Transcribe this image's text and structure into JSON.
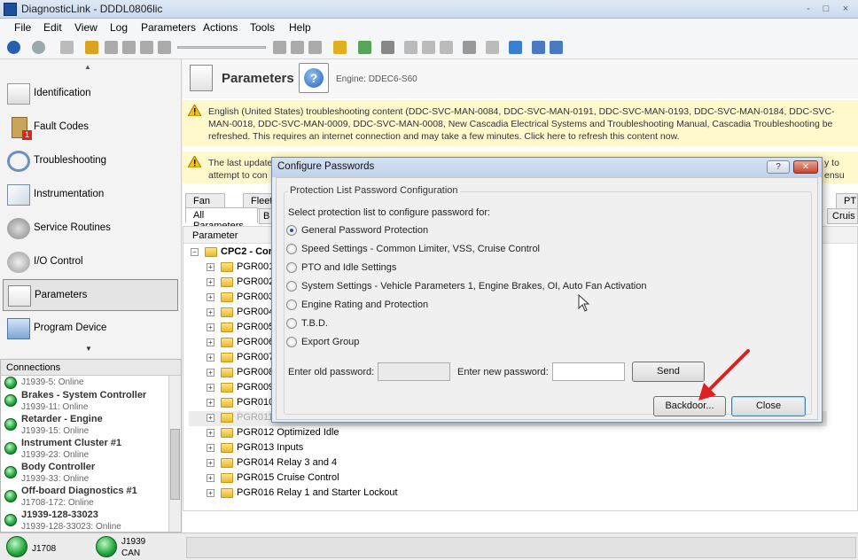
{
  "window": {
    "title": "DiagnosticLink - DDDL0806lic",
    "controls": [
      "-",
      "□",
      "×"
    ]
  },
  "menu": [
    "File",
    "Edit",
    "View",
    "Log",
    "Parameters",
    "Actions",
    "Tools",
    "Help"
  ],
  "sidebar": {
    "items": [
      {
        "label": "Identification",
        "icon": "identification-icon"
      },
      {
        "label": "Fault Codes",
        "icon": "fault-codes-icon",
        "badge": "1"
      },
      {
        "label": "Troubleshooting",
        "icon": "stethoscope-icon"
      },
      {
        "label": "Instrumentation",
        "icon": "gauge-icon"
      },
      {
        "label": "Service Routines",
        "icon": "gears-icon"
      },
      {
        "label": "I/O Control",
        "icon": "io-control-icon"
      },
      {
        "label": "Parameters",
        "icon": "parameters-icon",
        "selected": true
      },
      {
        "label": "Program Device",
        "icon": "program-device-icon"
      }
    ]
  },
  "connections": {
    "header": "Connections",
    "items": [
      {
        "name": "",
        "sub": "J1939-5: Online"
      },
      {
        "name": "Brakes - System Controller",
        "sub": "J1939-11: Online"
      },
      {
        "name": "Retarder - Engine",
        "sub": "J1939-15: Online"
      },
      {
        "name": "Instrument Cluster #1",
        "sub": "J1939-23: Online"
      },
      {
        "name": "Body Controller",
        "sub": "J1939-33: Online"
      },
      {
        "name": "Off-board Diagnostics #1",
        "sub": "J1708-172: Online"
      },
      {
        "name": "J1939-128-33023",
        "sub": "J1939-128-33023: Online"
      }
    ]
  },
  "statusbar": {
    "j1708": "J1708",
    "j1939": "J1939",
    "can": "CAN"
  },
  "main": {
    "title": "Parameters",
    "engine": "Engine: DDEC6-S60",
    "notice1": "English (United States) troubleshooting content (DDC-SVC-MAN-0084, DDC-SVC-MAN-0191, DDC-SVC-MAN-0193, DDC-SVC-MAN-0184, DDC-SVC-MAN-0018, DDC-SVC-MAN-0009, DDC-SVC-MAN-0008, New Cascadia Electrical Systems and Troubleshooting Manual, Cascadia Troubleshooting be refreshed. This requires an internet connection and may take a few minutes. Click here to refresh this content now.",
    "notice2_line1": "The last update",
    "notice2_line2": "attempt to con",
    "notice2_tail": "y to ensu",
    "tabs_row1": [
      "Fan",
      "Fleet",
      "PT"
    ],
    "tabs_row2": [
      "All Parameters",
      "B",
      "Cruis"
    ],
    "column_parameter": "Parameter",
    "tree": [
      {
        "label": "CPC2 - Con",
        "root": true
      },
      {
        "label": "PGR001"
      },
      {
        "label": "PGR002"
      },
      {
        "label": "PGR003"
      },
      {
        "label": "PGR004"
      },
      {
        "label": "PGR005"
      },
      {
        "label": "PGR006"
      },
      {
        "label": "PGR007"
      },
      {
        "label": "PGR008"
      },
      {
        "label": "PGR009"
      },
      {
        "label": "PGR010"
      },
      {
        "label": "PGR011",
        "grayed": true
      },
      {
        "label": "PGR012 Optimized Idle"
      },
      {
        "label": "PGR013 Inputs"
      },
      {
        "label": "PGR014 Relay 3 and 4"
      },
      {
        "label": "PGR015 Cruise Control"
      },
      {
        "label": "PGR016 Relay 1 and Starter Lockout"
      }
    ]
  },
  "dialog": {
    "title": "Configure Passwords",
    "help_btn": "?",
    "close_btn": "✕",
    "group_label": "Protection List Password Configuration",
    "prompt": "Select protection list to configure password for:",
    "options": [
      {
        "label": "General Password Protection",
        "checked": true
      },
      {
        "label": "Speed Settings - Common Limiter, VSS, Cruise Control",
        "checked": false
      },
      {
        "label": "PTO and Idle Settings",
        "checked": false
      },
      {
        "label": "System Settings - Vehicle Parameters 1, Engine Brakes, OI, Auto Fan Activation",
        "checked": false
      },
      {
        "label": "Engine Rating and Protection",
        "checked": false
      },
      {
        "label": "T.B.D.",
        "checked": false
      },
      {
        "label": "Export Group",
        "checked": false
      }
    ],
    "old_password_label": "Enter old password:",
    "old_password_value": "",
    "new_password_label": "Enter new password:",
    "new_password_value": "",
    "send": "Send",
    "backdoor": "Backdoor...",
    "close": "Close"
  },
  "colors": {
    "notice_bg": "#fff9cc",
    "annotation_arrow": "#e02020",
    "led_green": "#1ea43a"
  }
}
